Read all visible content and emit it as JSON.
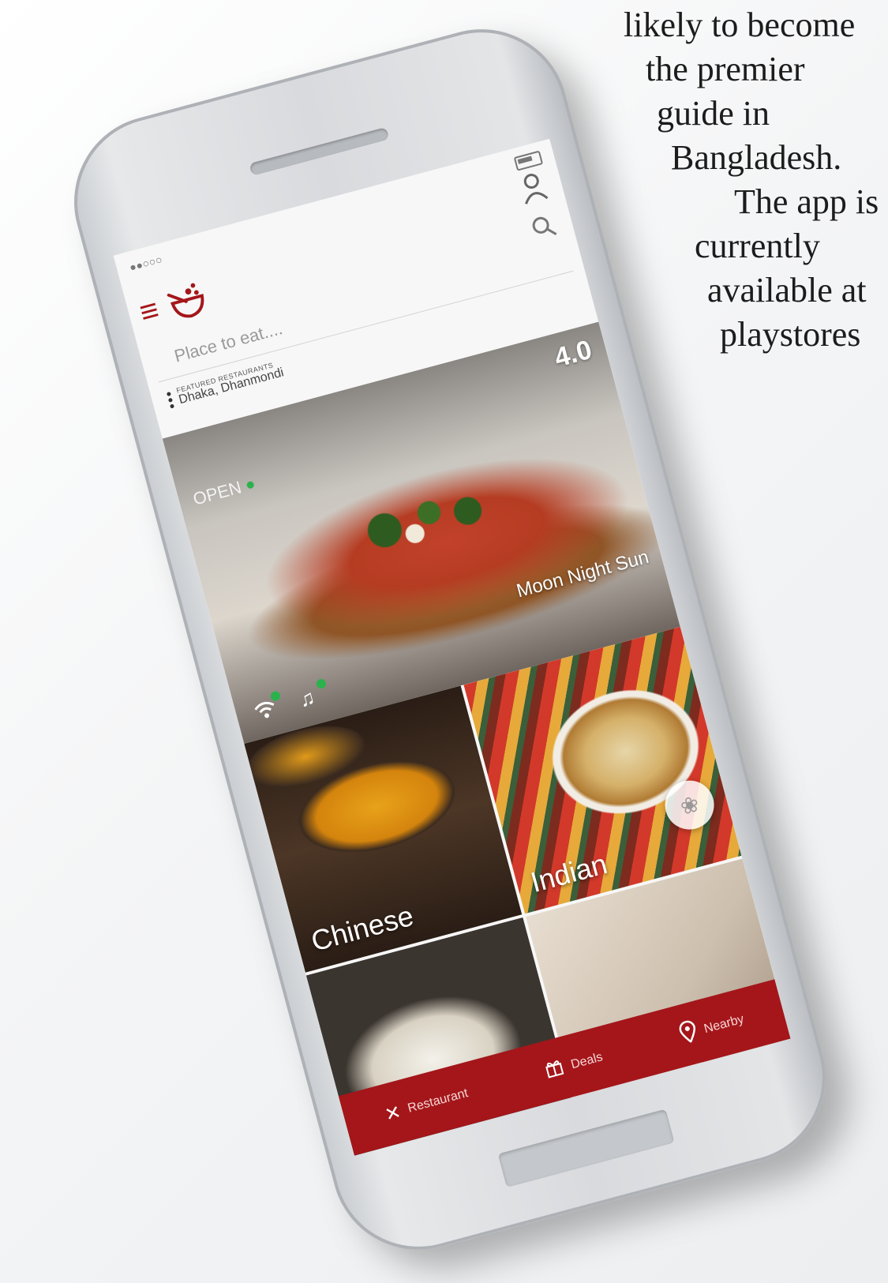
{
  "promo_lines": [
    "likely to become",
    "the premier",
    "guide in",
    "Bangladesh.",
    "The app is",
    "currently",
    "available at",
    "playstores"
  ],
  "status_bar": {
    "signal": "●●○○○"
  },
  "app": {
    "search_placeholder": "Place to eat....",
    "brand_color": "#a4161a"
  },
  "featured": {
    "label": "FEATURED RESTAURANTS",
    "location": "Dhaka, Dhanmondi",
    "restaurant_name": "Moon Night Sun",
    "rating": "4.0",
    "status": "OPEN",
    "status_color": "#2bb24c",
    "amenities": [
      "wifi-icon",
      "music-icon"
    ]
  },
  "categories": [
    {
      "label": "Chinese"
    },
    {
      "label": "Indian"
    }
  ],
  "bottom_nav": [
    {
      "label": "Restaurant",
      "icon": "fork-knife-icon"
    },
    {
      "label": "Deals",
      "icon": "gift-icon"
    },
    {
      "label": "Nearby",
      "icon": "location-pin-icon"
    }
  ]
}
